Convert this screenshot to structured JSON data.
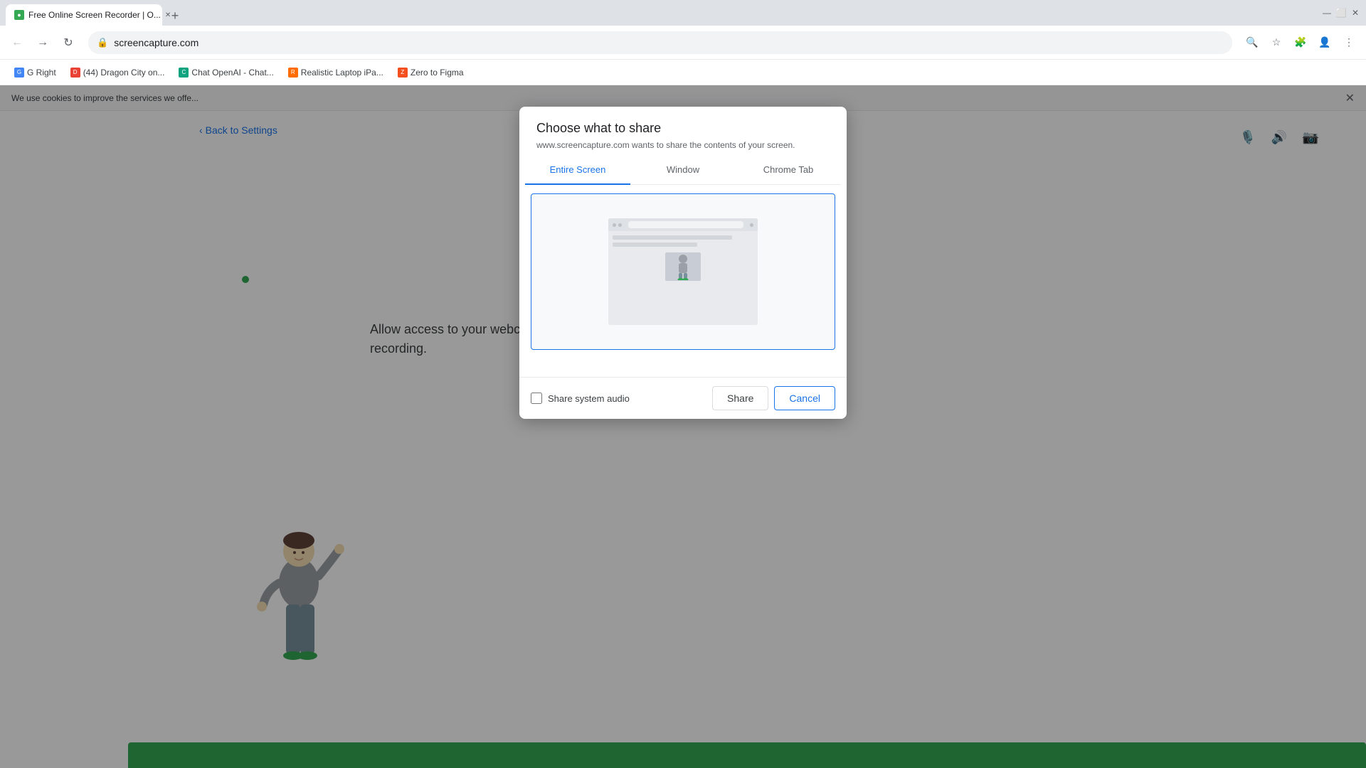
{
  "browser": {
    "tabs": [
      {
        "id": "active",
        "favicon_color": "#34a853",
        "label": "Free Online Screen Recorder | O...",
        "active": true
      },
      {
        "id": "new",
        "label": "+"
      }
    ],
    "url": "screencapture.com",
    "bookmarks": [
      {
        "label": "G Right",
        "favicon_color": "#4285f4"
      },
      {
        "label": "(44) Dragon City on...",
        "favicon_color": "#e94235"
      },
      {
        "label": "Chat OpenAI - Chat...",
        "favicon_color": "#10a37f"
      },
      {
        "label": "Realistic Laptop iPa...",
        "favicon_color": "#ff6d00"
      },
      {
        "label": "Zero to Figma",
        "favicon_color": "#f24e1e"
      }
    ]
  },
  "page": {
    "back_link": "Back to Settings",
    "cookie_text": "We use cookies to improve the services we offe...",
    "right_text": "Allow access to your webcam and mic to start screen recording."
  },
  "modal": {
    "title": "Choose what to share",
    "subtitle": "www.screencapture.com wants to share the contents of your screen.",
    "tabs": [
      {
        "label": "Entire Screen",
        "active": true
      },
      {
        "label": "Window",
        "active": false
      },
      {
        "label": "Chrome Tab",
        "active": false
      }
    ],
    "share_audio_label": "Share system audio",
    "share_btn_label": "Share",
    "cancel_btn_label": "Cancel"
  }
}
